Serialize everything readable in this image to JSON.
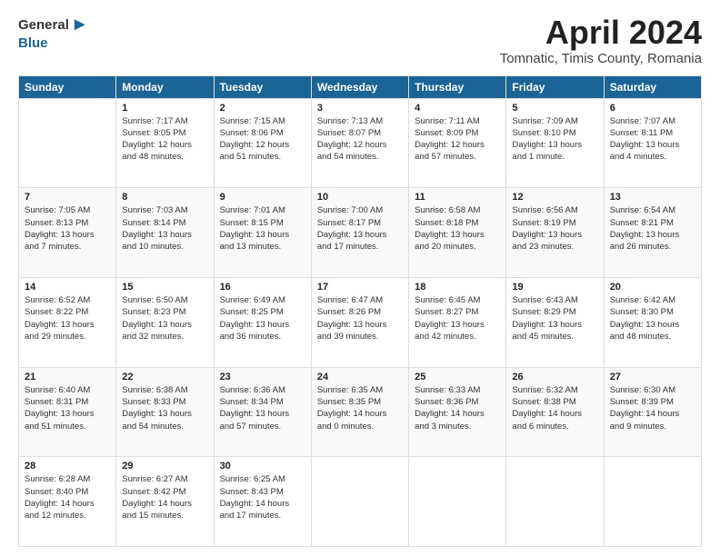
{
  "logo": {
    "general": "General",
    "blue": "Blue"
  },
  "title": "April 2024",
  "location": "Tomnatic, Timis County, Romania",
  "days": [
    "Sunday",
    "Monday",
    "Tuesday",
    "Wednesday",
    "Thursday",
    "Friday",
    "Saturday"
  ],
  "weeks": [
    [
      {
        "num": "",
        "info": ""
      },
      {
        "num": "1",
        "info": "Sunrise: 7:17 AM\nSunset: 8:05 PM\nDaylight: 12 hours\nand 48 minutes."
      },
      {
        "num": "2",
        "info": "Sunrise: 7:15 AM\nSunset: 8:06 PM\nDaylight: 12 hours\nand 51 minutes."
      },
      {
        "num": "3",
        "info": "Sunrise: 7:13 AM\nSunset: 8:07 PM\nDaylight: 12 hours\nand 54 minutes."
      },
      {
        "num": "4",
        "info": "Sunrise: 7:11 AM\nSunset: 8:09 PM\nDaylight: 12 hours\nand 57 minutes."
      },
      {
        "num": "5",
        "info": "Sunrise: 7:09 AM\nSunset: 8:10 PM\nDaylight: 13 hours\nand 1 minute."
      },
      {
        "num": "6",
        "info": "Sunrise: 7:07 AM\nSunset: 8:11 PM\nDaylight: 13 hours\nand 4 minutes."
      }
    ],
    [
      {
        "num": "7",
        "info": "Sunrise: 7:05 AM\nSunset: 8:13 PM\nDaylight: 13 hours\nand 7 minutes."
      },
      {
        "num": "8",
        "info": "Sunrise: 7:03 AM\nSunset: 8:14 PM\nDaylight: 13 hours\nand 10 minutes."
      },
      {
        "num": "9",
        "info": "Sunrise: 7:01 AM\nSunset: 8:15 PM\nDaylight: 13 hours\nand 13 minutes."
      },
      {
        "num": "10",
        "info": "Sunrise: 7:00 AM\nSunset: 8:17 PM\nDaylight: 13 hours\nand 17 minutes."
      },
      {
        "num": "11",
        "info": "Sunrise: 6:58 AM\nSunset: 8:18 PM\nDaylight: 13 hours\nand 20 minutes."
      },
      {
        "num": "12",
        "info": "Sunrise: 6:56 AM\nSunset: 8:19 PM\nDaylight: 13 hours\nand 23 minutes."
      },
      {
        "num": "13",
        "info": "Sunrise: 6:54 AM\nSunset: 8:21 PM\nDaylight: 13 hours\nand 26 minutes."
      }
    ],
    [
      {
        "num": "14",
        "info": "Sunrise: 6:52 AM\nSunset: 8:22 PM\nDaylight: 13 hours\nand 29 minutes."
      },
      {
        "num": "15",
        "info": "Sunrise: 6:50 AM\nSunset: 8:23 PM\nDaylight: 13 hours\nand 32 minutes."
      },
      {
        "num": "16",
        "info": "Sunrise: 6:49 AM\nSunset: 8:25 PM\nDaylight: 13 hours\nand 36 minutes."
      },
      {
        "num": "17",
        "info": "Sunrise: 6:47 AM\nSunset: 8:26 PM\nDaylight: 13 hours\nand 39 minutes."
      },
      {
        "num": "18",
        "info": "Sunrise: 6:45 AM\nSunset: 8:27 PM\nDaylight: 13 hours\nand 42 minutes."
      },
      {
        "num": "19",
        "info": "Sunrise: 6:43 AM\nSunset: 8:29 PM\nDaylight: 13 hours\nand 45 minutes."
      },
      {
        "num": "20",
        "info": "Sunrise: 6:42 AM\nSunset: 8:30 PM\nDaylight: 13 hours\nand 48 minutes."
      }
    ],
    [
      {
        "num": "21",
        "info": "Sunrise: 6:40 AM\nSunset: 8:31 PM\nDaylight: 13 hours\nand 51 minutes."
      },
      {
        "num": "22",
        "info": "Sunrise: 6:38 AM\nSunset: 8:33 PM\nDaylight: 13 hours\nand 54 minutes."
      },
      {
        "num": "23",
        "info": "Sunrise: 6:36 AM\nSunset: 8:34 PM\nDaylight: 13 hours\nand 57 minutes."
      },
      {
        "num": "24",
        "info": "Sunrise: 6:35 AM\nSunset: 8:35 PM\nDaylight: 14 hours\nand 0 minutes."
      },
      {
        "num": "25",
        "info": "Sunrise: 6:33 AM\nSunset: 8:36 PM\nDaylight: 14 hours\nand 3 minutes."
      },
      {
        "num": "26",
        "info": "Sunrise: 6:32 AM\nSunset: 8:38 PM\nDaylight: 14 hours\nand 6 minutes."
      },
      {
        "num": "27",
        "info": "Sunrise: 6:30 AM\nSunset: 8:39 PM\nDaylight: 14 hours\nand 9 minutes."
      }
    ],
    [
      {
        "num": "28",
        "info": "Sunrise: 6:28 AM\nSunset: 8:40 PM\nDaylight: 14 hours\nand 12 minutes."
      },
      {
        "num": "29",
        "info": "Sunrise: 6:27 AM\nSunset: 8:42 PM\nDaylight: 14 hours\nand 15 minutes."
      },
      {
        "num": "30",
        "info": "Sunrise: 6:25 AM\nSunset: 8:43 PM\nDaylight: 14 hours\nand 17 minutes."
      },
      {
        "num": "",
        "info": ""
      },
      {
        "num": "",
        "info": ""
      },
      {
        "num": "",
        "info": ""
      },
      {
        "num": "",
        "info": ""
      }
    ]
  ]
}
